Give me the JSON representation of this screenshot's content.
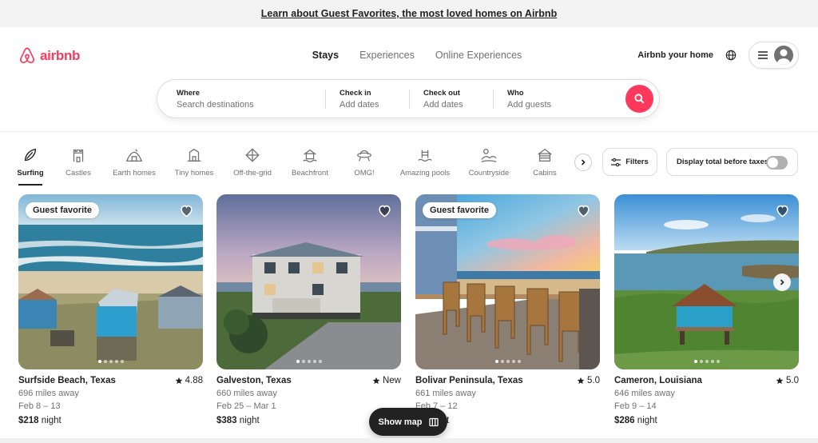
{
  "banner": {
    "text": "Learn about Guest Favorites, the most loved homes on Airbnb"
  },
  "header": {
    "logo_text": "airbnb",
    "brand_color": "#ff385c",
    "nav": [
      {
        "label": "Stays",
        "active": true
      },
      {
        "label": "Experiences",
        "active": false
      },
      {
        "label": "Online Experiences",
        "active": false
      }
    ],
    "host_link": "Airbnb your home",
    "icons": {
      "globe": "globe-icon",
      "menu": "hamburger-icon",
      "avatar": "user-avatar-icon"
    }
  },
  "search": {
    "where": {
      "label": "Where",
      "placeholder": "Search destinations"
    },
    "check_in": {
      "label": "Check in",
      "placeholder": "Add dates"
    },
    "check_out": {
      "label": "Check out",
      "placeholder": "Add dates"
    },
    "who": {
      "label": "Who",
      "placeholder": "Add guests"
    }
  },
  "categories": {
    "items": [
      {
        "label": "Surfing",
        "icon": "surfboard-icon",
        "active": true
      },
      {
        "label": "Castles",
        "icon": "castle-icon",
        "active": false
      },
      {
        "label": "Earth homes",
        "icon": "earth-home-icon",
        "active": false
      },
      {
        "label": "Tiny homes",
        "icon": "tiny-home-icon",
        "active": false
      },
      {
        "label": "Off-the-grid",
        "icon": "off-grid-icon",
        "active": false
      },
      {
        "label": "Beachfront",
        "icon": "beachfront-icon",
        "active": false
      },
      {
        "label": "OMG!",
        "icon": "ufo-icon",
        "active": false
      },
      {
        "label": "Amazing pools",
        "icon": "pool-icon",
        "active": false
      },
      {
        "label": "Countryside",
        "icon": "countryside-icon",
        "active": false
      },
      {
        "label": "Cabins",
        "icon": "cabin-icon",
        "active": false
      }
    ],
    "filters_label": "Filters",
    "tax_toggle_label": "Display total before taxes"
  },
  "listings": [
    {
      "badge": "Guest favorite",
      "title": "Surfside Beach, Texas",
      "rating": "4.88",
      "distance": "696 miles away",
      "dates": "Feb 8 – 13",
      "price": "$218",
      "price_unit": "night"
    },
    {
      "badge": "",
      "title": "Galveston, Texas",
      "rating": "New",
      "distance": "660 miles away",
      "dates": "Feb 25 – Mar 1",
      "price": "$383",
      "price_unit": "night"
    },
    {
      "badge": "Guest favorite",
      "title": "Bolivar Peninsula, Texas",
      "rating": "5.0",
      "distance": "661 miles away",
      "dates": "Feb 7 – 12",
      "price": "$--",
      "price_unit": "night"
    },
    {
      "badge": "",
      "title": "Cameron, Louisiana",
      "rating": "5.0",
      "distance": "646 miles away",
      "dates": "Feb 9 – 14",
      "price": "$286",
      "price_unit": "night"
    }
  ],
  "show_map": {
    "label": "Show map"
  }
}
